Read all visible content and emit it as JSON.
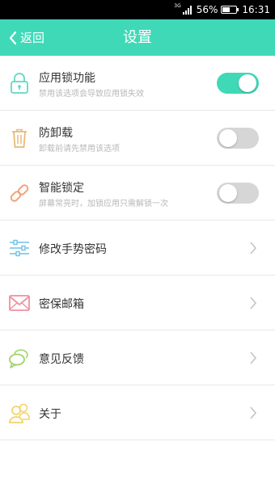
{
  "status_bar": {
    "network": "3G",
    "battery_percent_text": "56%",
    "battery_level": 0.56,
    "time": "16:31"
  },
  "header": {
    "back_label": "返回",
    "title": "设置"
  },
  "settings": [
    {
      "label": "应用锁功能",
      "sub": "禁用该选项会导致应用锁失效",
      "icon": "padlock-icon",
      "control": "toggle",
      "on": true
    },
    {
      "label": "防卸载",
      "sub": "卸载前请先禁用该选项",
      "icon": "trash-can-icon",
      "control": "toggle",
      "on": false
    },
    {
      "label": "智能锁定",
      "sub": "屏幕常亮时，加锁应用只需解锁一次",
      "icon": "link-icon",
      "control": "toggle",
      "on": false
    },
    {
      "label": "修改手势密码",
      "icon": "gesture-sliders-icon",
      "control": "chevron"
    },
    {
      "label": "密保邮箱",
      "icon": "envelope-icon",
      "control": "chevron"
    },
    {
      "label": "意见反馈",
      "icon": "speech-bubbles-icon",
      "control": "chevron"
    },
    {
      "label": "关于",
      "icon": "people-icon",
      "control": "chevron"
    }
  ],
  "colors": {
    "accent": "#3fd9b8",
    "toggle_off": "#d6d6d6",
    "icon_lock": "#5fd8c4",
    "icon_trash": "#e8b97a",
    "icon_link": "#f0a27a",
    "icon_sliders": "#6fc1e8",
    "icon_mail": "#f08fa0",
    "icon_chat": "#9fd36a",
    "icon_people": "#f3d36a"
  }
}
